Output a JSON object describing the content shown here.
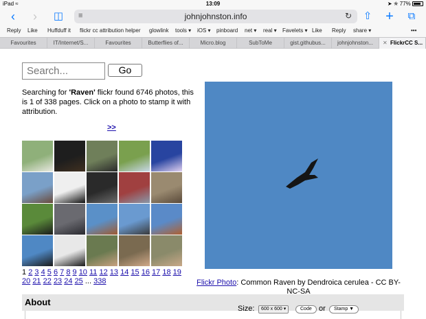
{
  "status": {
    "device": "iPad",
    "time": "13:09",
    "battery": "77%"
  },
  "toolbar": {
    "url": "johnjohnston.info"
  },
  "bookmarks": [
    "Reply",
    "Like",
    "Huffduff it",
    "flickr cc attribution helper",
    "glowlink",
    "tools ▾",
    "iOS ▾",
    "pinboard",
    "net ▾",
    "real ▾",
    "Favelets ▾",
    "Like",
    "Reply",
    "share ▾"
  ],
  "tabs": [
    "Favourites",
    "IT/Internet/S...",
    "Favourites",
    "Butterflies of...",
    "Micro.blog",
    "SubToMe",
    "gist.githubus...",
    "johnjohnston...",
    "FlickrCC S..."
  ],
  "search": {
    "placeholder": "Search...",
    "go_label": "Go"
  },
  "result": {
    "prefix": "Searching for ",
    "query": "'Raven'",
    "suffix": " flickr found 6746 photos, this is 1 of 338 pages. Click on a photo to stamp it with attribution.",
    "next": ">>"
  },
  "thumbnails": [
    {
      "name": "birch-trees",
      "colors": [
        "#8fb07a",
        "#e8e8e0"
      ]
    },
    {
      "name": "black-cat",
      "colors": [
        "#1e1e1e",
        "#403020"
      ]
    },
    {
      "name": "raven-on-rock",
      "colors": [
        "#6f7f5a",
        "#2a2a2a"
      ]
    },
    {
      "name": "pine-forest",
      "colors": [
        "#7aa04e",
        "#c8d8e8"
      ]
    },
    {
      "name": "raven-costume",
      "colors": [
        "#2844a0",
        "#e0d0f0"
      ]
    },
    {
      "name": "bird-on-post",
      "colors": [
        "#7aa0c8",
        "#6a4a3a"
      ]
    },
    {
      "name": "raven-silhouette",
      "colors": [
        "#efefef",
        "#111111"
      ]
    },
    {
      "name": "raven-dark",
      "colors": [
        "#2a2a2a",
        "#6a6a6a"
      ]
    },
    {
      "name": "street-shop",
      "colors": [
        "#a04040",
        "#8899aa"
      ]
    },
    {
      "name": "carved-wood",
      "colors": [
        "#9a8a70",
        "#5a4a3a"
      ]
    },
    {
      "name": "raven-grass",
      "colors": [
        "#5a8a3a",
        "#1a1a1a"
      ]
    },
    {
      "name": "raven-figure",
      "colors": [
        "#6a6a70",
        "#2a2a30"
      ]
    },
    {
      "name": "flying-bird-1",
      "colors": [
        "#5a90c8",
        "#a05a30"
      ]
    },
    {
      "name": "flying-bird-2",
      "colors": [
        "#6a9ad0",
        "#3a3a3a"
      ]
    },
    {
      "name": "flying-bird-3",
      "colors": [
        "#5a8ac8",
        "#b06030"
      ]
    },
    {
      "name": "raven-sky",
      "colors": [
        "#4f88c4",
        "#1a1a1a"
      ]
    },
    {
      "name": "dark-figure",
      "colors": [
        "#e8e8e8",
        "#1a1a1a"
      ]
    },
    {
      "name": "bird-in-hand-1",
      "colors": [
        "#6a7a50",
        "#c8a080"
      ]
    },
    {
      "name": "bird-in-hand-2",
      "colors": [
        "#7a6a50",
        "#d0a888"
      ]
    },
    {
      "name": "bird-in-hand-3",
      "colors": [
        "#8a8a6a",
        "#c8a888"
      ]
    }
  ],
  "pager": {
    "current": "1",
    "pages": [
      "2",
      "3",
      "4",
      "5",
      "6",
      "7",
      "8",
      "9",
      "10",
      "11",
      "12",
      "13",
      "14",
      "15",
      "16",
      "17",
      "18",
      "19",
      "20",
      "21",
      "22",
      "23",
      "24",
      "25"
    ],
    "ellipsis": "...",
    "last": "338"
  },
  "preview": {
    "sky_color": "#4f88c4"
  },
  "caption": {
    "link": "Flickr Photo",
    "text": ": Common Raven by Dendroica cerulea - CC BY-NC-SA"
  },
  "about": {
    "title": "About"
  },
  "size": {
    "label": "Size:",
    "selected": "600 x 600",
    "code_label": "Code",
    "or_label": "or",
    "stamp_label": "Stamp ▼"
  }
}
